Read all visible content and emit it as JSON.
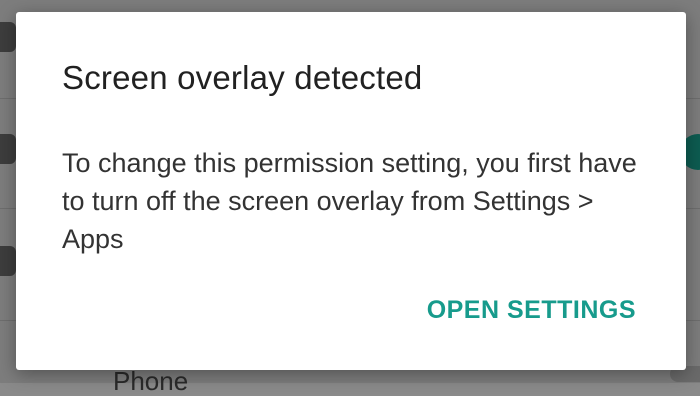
{
  "background": {
    "partial_label": "Phone"
  },
  "dialog": {
    "title": "Screen overlay detected",
    "message": "To change this permission setting, you first have to turn off the screen overlay from Settings > Apps",
    "action_label": "OPEN SETTINGS"
  },
  "colors": {
    "accent": "#179b8c",
    "title_text": "#212121",
    "body_text": "#333333",
    "scrim": "#7d7d7d"
  }
}
